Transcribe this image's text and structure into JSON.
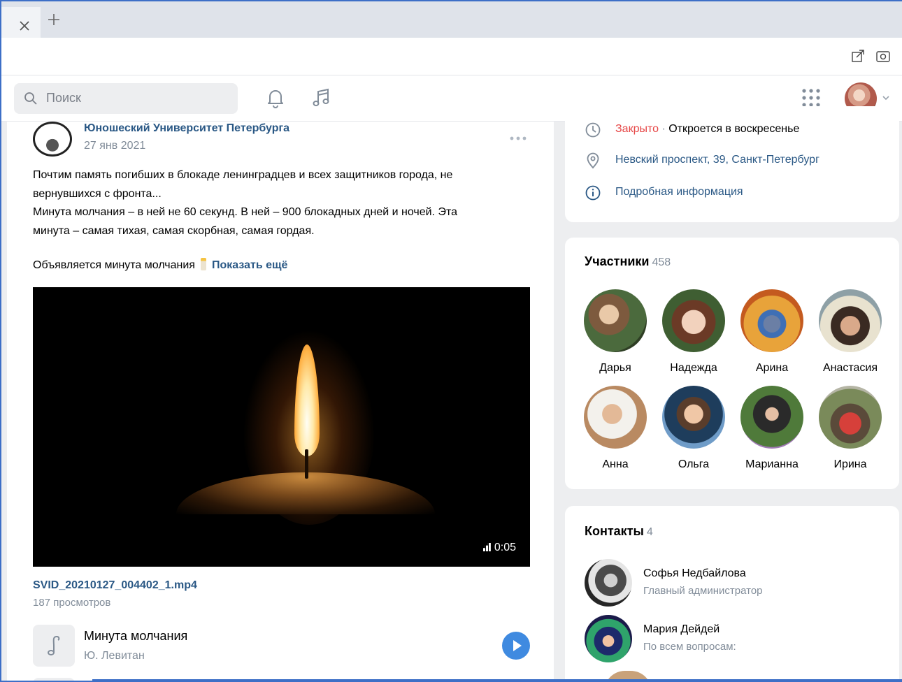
{
  "browser": {
    "tab_close_icon": "close-icon",
    "new_tab_icon": "plus-icon",
    "toolbar_icons": [
      "share-icon",
      "screenshot-icon"
    ]
  },
  "header": {
    "search_placeholder": "Поиск",
    "icons": [
      "search-icon",
      "bell-icon",
      "music-icon",
      "apps-grid-icon",
      "chevron-down-icon"
    ]
  },
  "post": {
    "author": "Юношеский Университет Петербурга",
    "date": "27 янв 2021",
    "text_lines": [
      "Почтим память погибших в блокаде ленинградцев и всех защитников города, не",
      "вернувшихся с фронта...",
      "Минута молчания – в ней не 60 секунд. В ней – 900 блокадных дней и ночей. Эта",
      "минута – самая тихая, самая скорбная, самая гордая."
    ],
    "truncated_line": "Объявляется минута молчания",
    "show_more": "Показать ещё",
    "video": {
      "duration": "0:05",
      "filename": "SVID_20210127_004402_1.mp4",
      "views": "187 просмотров"
    },
    "audio": {
      "title": "Минута молчания",
      "artist": "Ю. Левитан"
    }
  },
  "info": {
    "status_closed": "Закрыто",
    "status_separator": " · ",
    "status_open": "Откроется в воскресенье",
    "address": "Невский проспект, 39, Санкт-Петербург",
    "more_info": "Подробная информация"
  },
  "members": {
    "title": "Участники",
    "count": "458",
    "list": [
      {
        "name": "Дарья"
      },
      {
        "name": "Надежда"
      },
      {
        "name": "Арина"
      },
      {
        "name": "Анастасия"
      },
      {
        "name": "Анна"
      },
      {
        "name": "Ольга"
      },
      {
        "name": "Марианна"
      },
      {
        "name": "Ирина"
      }
    ]
  },
  "contacts": {
    "title": "Контакты",
    "count": "4",
    "list": [
      {
        "name": "Софья Недбайлова",
        "role": "Главный администратор"
      },
      {
        "name": "Мария Дейдей",
        "role": "По всем вопросам:"
      }
    ]
  },
  "colors": {
    "link": "#2a5885",
    "closed": "#e64646",
    "secondary": "#818c99",
    "play_button": "#3f8ae0",
    "frame": "#3d6fc7"
  }
}
